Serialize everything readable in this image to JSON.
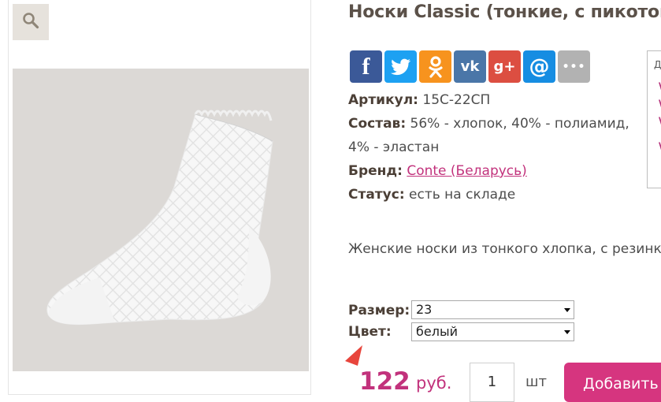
{
  "product": {
    "title": "Носки Classic (тонкие, с пикотом)",
    "article_label": "Артикул:",
    "article_value": "15С-22СП",
    "composition_label": "Состав:",
    "composition_value_line1": "56% - хлопок, 40% - полиамид,",
    "composition_value_line2": "4% - эластан",
    "brand_label": "Бренд:",
    "brand_value": "Conte (Беларусь)",
    "status_label": "Статус:",
    "status_value": "есть на складе",
    "description": "Женские носки из тонкого хлопка, с резинкой"
  },
  "share": {
    "facebook": "f",
    "twitter": "twitter-bird-icon",
    "odnoklassniki": "ok-icon",
    "vk": "vk",
    "googleplus": "g+",
    "mail": "@",
    "more": "•••"
  },
  "options": {
    "size_label": "Размер:",
    "size_value": "23",
    "color_label": "Цвет:",
    "color_value": "белый"
  },
  "purchase": {
    "price": "122",
    "currency": "руб.",
    "quantity": "1",
    "unit": "шт",
    "add_button": "Добавить в корзину"
  },
  "side_box": {
    "title_fragment": "Д",
    "marks": [
      "\\",
      "\\",
      "\\",
      "\\"
    ]
  },
  "colors": {
    "accent": "#c2327c",
    "button": "#d6357f",
    "title": "#5b5149"
  }
}
